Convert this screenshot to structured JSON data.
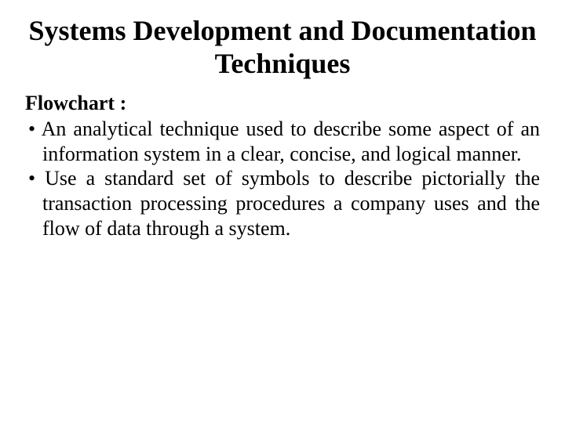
{
  "title": "Systems Development and Documentation Techniques",
  "section_heading": "Flowchart :",
  "bullets": [
    "An analytical technique used to describe some aspect of an information system in a clear, concise, and logical manner.",
    "Use a standard set of symbols to describe pictorially the transaction processing procedures a company uses and the flow of data through a system."
  ]
}
